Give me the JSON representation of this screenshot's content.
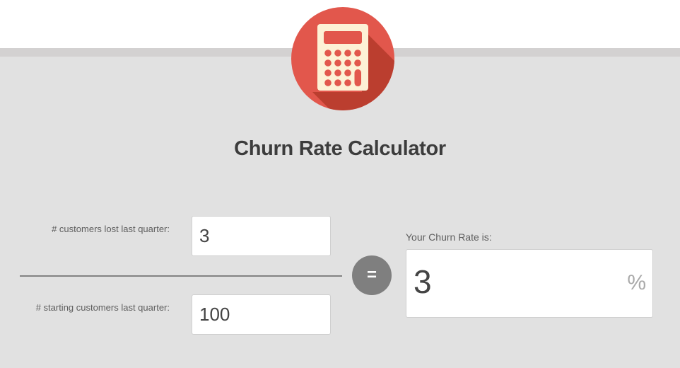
{
  "header": {
    "icon": "calculator-icon",
    "icon_bg_color": "#e2574c",
    "icon_fg_color": "#fdf1d5"
  },
  "title": "Churn Rate Calculator",
  "form": {
    "customers_lost": {
      "label": "# customers lost last quarter:",
      "value": "3"
    },
    "starting_customers": {
      "label": "# starting customers last quarter:",
      "value": "100"
    },
    "equals_sign": "="
  },
  "result": {
    "label": "Your Churn Rate is:",
    "value": "3",
    "unit": "%"
  }
}
